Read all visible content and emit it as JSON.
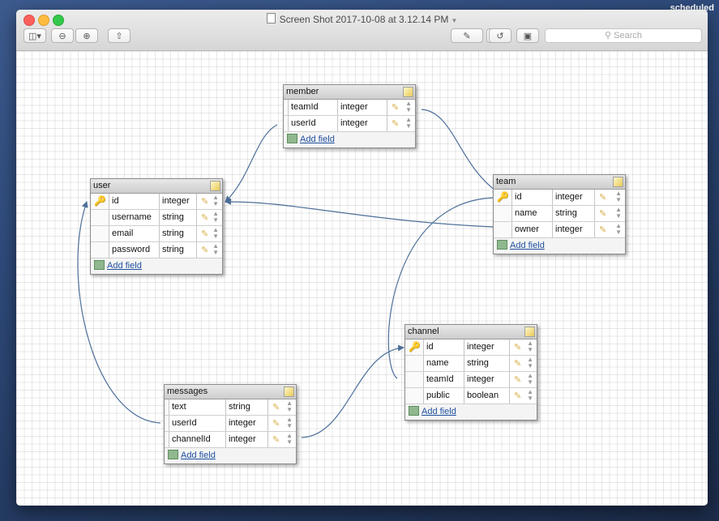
{
  "desktop": {
    "corner_label": "scheduled"
  },
  "window": {
    "title": "Screen Shot 2017-10-08 at 3.12.14 PM"
  },
  "toolbar": {
    "search_placeholder": "Search"
  },
  "colors": {
    "connector": "#4d6f9a",
    "link": "#1e4f9e",
    "key": "#e2ac24"
  },
  "add_field_label": "Add field",
  "tables": {
    "member": {
      "name": "member",
      "fields": [
        {
          "name": "teamId",
          "type": "integer",
          "key": false
        },
        {
          "name": "userId",
          "type": "integer",
          "key": false
        }
      ]
    },
    "user": {
      "name": "user",
      "fields": [
        {
          "name": "id",
          "type": "integer",
          "key": true
        },
        {
          "name": "username",
          "type": "string",
          "key": false
        },
        {
          "name": "email",
          "type": "string",
          "key": false
        },
        {
          "name": "password",
          "type": "string",
          "key": false
        }
      ]
    },
    "team": {
      "name": "team",
      "fields": [
        {
          "name": "id",
          "type": "integer",
          "key": true
        },
        {
          "name": "name",
          "type": "string",
          "key": false
        },
        {
          "name": "owner",
          "type": "integer",
          "key": false
        }
      ]
    },
    "channel": {
      "name": "channel",
      "fields": [
        {
          "name": "id",
          "type": "integer",
          "key": true
        },
        {
          "name": "name",
          "type": "string",
          "key": false
        },
        {
          "name": "teamId",
          "type": "integer",
          "key": false
        },
        {
          "name": "public",
          "type": "boolean",
          "key": false
        }
      ]
    },
    "messages": {
      "name": "messages",
      "fields": [
        {
          "name": "text",
          "type": "string",
          "key": false
        },
        {
          "name": "userId",
          "type": "integer",
          "key": false
        },
        {
          "name": "channelId",
          "type": "integer",
          "key": false
        }
      ]
    }
  }
}
